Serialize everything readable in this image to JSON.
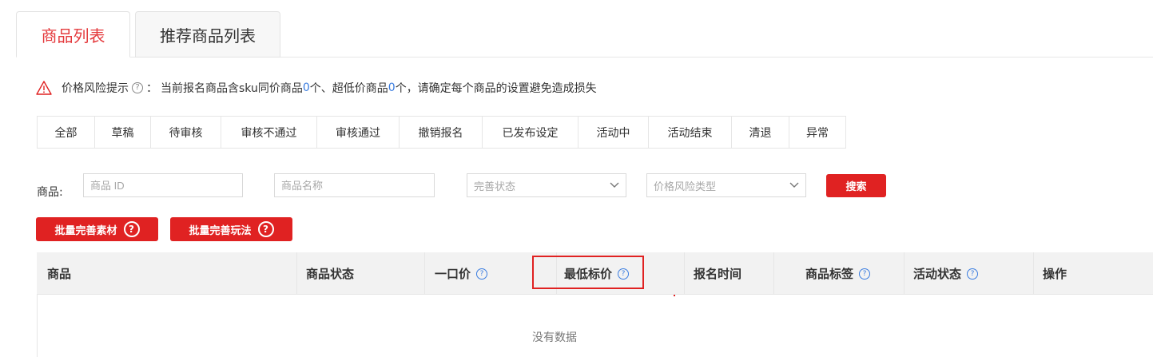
{
  "tabs": [
    {
      "label": "商品列表",
      "active": true
    },
    {
      "label": "推荐商品列表",
      "active": false
    }
  ],
  "notice": {
    "title": "价格风险提示",
    "help_icon": "?",
    "colon": "：",
    "text_1": "当前报名商品含sku同价商品",
    "count_1": "0",
    "text_2": "个、超低价商品",
    "count_2": "0",
    "text_3": "个，请确定每个商品的设置避免造成损失"
  },
  "status_filters": [
    "全部",
    "草稿",
    "待审核",
    "审核不通过",
    "审核通过",
    "撤销报名",
    "已发布设定",
    "活动中",
    "活动结束",
    "清退",
    "异常"
  ],
  "search": {
    "label": "商品:",
    "product_id_placeholder": "商品 ID",
    "product_name_placeholder": "商品名称",
    "status_select": "完善状态",
    "risk_select": "价格风险类型",
    "search_button": "搜索"
  },
  "batch_buttons": {
    "material": "批量完善素材",
    "gameplay": "批量完善玩法",
    "help_glyph": "?"
  },
  "table": {
    "headers": {
      "product": "商品",
      "status": "商品状态",
      "price": "一口价",
      "min_price": "最低标价",
      "signup_time": "报名时间",
      "tags": "商品标签",
      "activity_status": "活动状态",
      "actions": "操作"
    },
    "help_glyph": "?",
    "empty_text": "没有数据"
  },
  "colors": {
    "accent_red": "#e02222",
    "tab_active": "#e4393c",
    "link_blue": "#3b7de0"
  }
}
